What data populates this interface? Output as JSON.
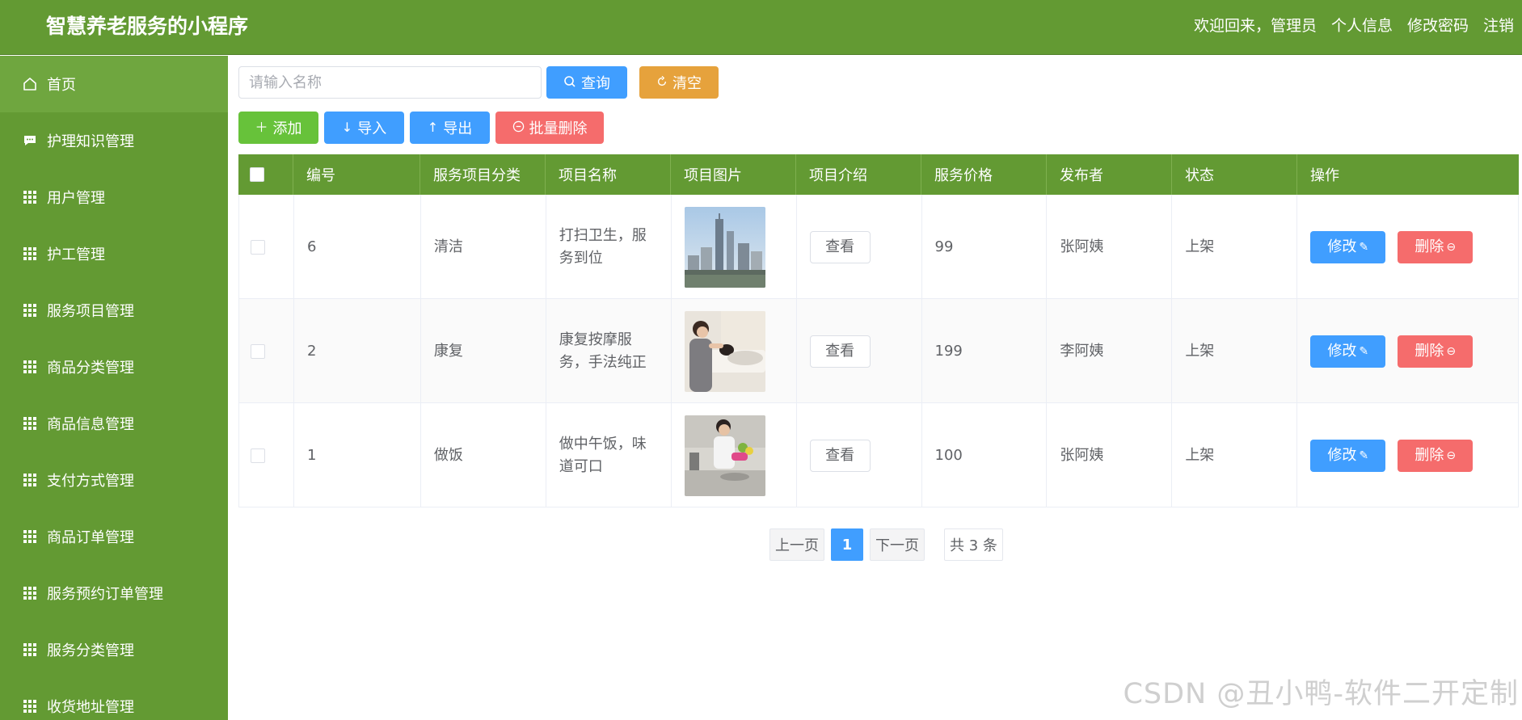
{
  "app": {
    "title": "智慧养老服务的小程序"
  },
  "header": {
    "welcome": "欢迎回来，管理员",
    "profile": "个人信息",
    "change_password": "修改密码",
    "logout": "注销"
  },
  "sidebar": {
    "items": [
      {
        "label": "首页",
        "icon": "home-icon"
      },
      {
        "label": "护理知识管理",
        "icon": "chat-icon"
      },
      {
        "label": "用户管理",
        "icon": "grid-icon"
      },
      {
        "label": "护工管理",
        "icon": "grid-icon"
      },
      {
        "label": "服务项目管理",
        "icon": "grid-icon"
      },
      {
        "label": "商品分类管理",
        "icon": "grid-icon"
      },
      {
        "label": "商品信息管理",
        "icon": "grid-icon"
      },
      {
        "label": "支付方式管理",
        "icon": "grid-icon"
      },
      {
        "label": "商品订单管理",
        "icon": "grid-icon"
      },
      {
        "label": "服务预约订单管理",
        "icon": "grid-icon"
      },
      {
        "label": "服务分类管理",
        "icon": "grid-icon"
      },
      {
        "label": "收货地址管理",
        "icon": "grid-icon"
      }
    ]
  },
  "toolbar": {
    "search_placeholder": "请输入名称",
    "search_value": "",
    "query": "查询",
    "clear": "清空",
    "add": "添加",
    "import": "导入",
    "export": "导出",
    "batch_delete": "批量删除"
  },
  "table": {
    "headers": [
      "编号",
      "服务项目分类",
      "项目名称",
      "项目图片",
      "项目介绍",
      "服务价格",
      "发布者",
      "状态",
      "操作"
    ],
    "rows": [
      {
        "id": "6",
        "category": "清洁",
        "name": "打扫卫生，服务到位",
        "image": "city-skyline-photo",
        "intro_btn": "查看",
        "price": "99",
        "publisher": "张阿姨",
        "status": "上架",
        "edit": "修改",
        "delete": "删除"
      },
      {
        "id": "2",
        "category": "康复",
        "name": "康复按摩服务，手法纯正",
        "image": "massage-photo",
        "intro_btn": "查看",
        "price": "199",
        "publisher": "李阿姨",
        "status": "上架",
        "edit": "修改",
        "delete": "删除"
      },
      {
        "id": "1",
        "category": "做饭",
        "name": "做中午饭，味道可口",
        "image": "cooking-photo",
        "intro_btn": "查看",
        "price": "100",
        "publisher": "张阿姨",
        "status": "上架",
        "edit": "修改",
        "delete": "删除"
      }
    ]
  },
  "pagination": {
    "prev": "上一页",
    "current": "1",
    "next": "下一页",
    "total": "共 3 条"
  },
  "watermark": "CSDN @丑小鸭-软件二开定制",
  "colors": {
    "theme_green": "#639a33",
    "primary_blue": "#409eff",
    "warning_orange": "#e6a23c",
    "success_green": "#67c23a",
    "danger_red": "#f56c6c"
  }
}
